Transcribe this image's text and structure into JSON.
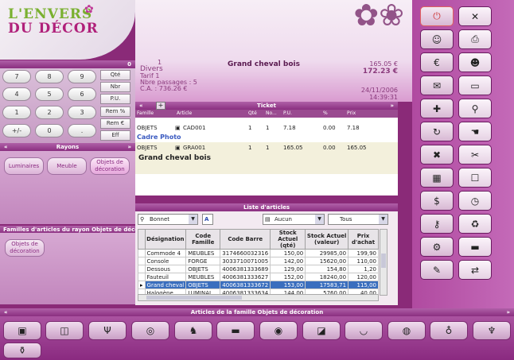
{
  "logo": {
    "line1": "L'ENVERS",
    "line2": "DU DÉCOR"
  },
  "info": {
    "number": "1",
    "category": "Divers",
    "tarif": "Tarif 1",
    "passages": "Nbre passages : 5",
    "ca": "C.A. : 736.26 €",
    "product": "Grand cheval bois",
    "price1": "165.05 €",
    "price2": "172.23 €",
    "date": "24/11/2006",
    "time": "14:39:31"
  },
  "keypad": {
    "counter": "0",
    "keys": [
      "7",
      "8",
      "9",
      "4",
      "5",
      "6",
      "1",
      "2",
      "3",
      "+/-",
      "0",
      "."
    ],
    "fkeys": [
      "Qté",
      "Nbr",
      "P.U.",
      "Rem %",
      "Rem €",
      "Eff"
    ]
  },
  "rayons": {
    "title": "Rayons",
    "items": [
      "Luminaires",
      "Meuble",
      "Objets de décoration"
    ]
  },
  "famarts": {
    "title": "Familles d'articles du rayon Objets de déco",
    "items": [
      "Objets de décoration"
    ]
  },
  "ticket": {
    "title": "Ticket",
    "headers": [
      "Famille",
      "Article",
      "Qté",
      "No...",
      "P.U.",
      "%",
      "Prix"
    ],
    "rows": [
      {
        "famille": "OBJETS",
        "article": "CAD001",
        "qte": "1",
        "no": "1",
        "pu": "7.18",
        "pct": "0.00",
        "prix": "7.18",
        "label": "Cadre Photo"
      },
      {
        "famille": "OBJETS",
        "article": "GRA001",
        "qte": "1",
        "no": "1",
        "pu": "165.05",
        "pct": "0.00",
        "prix": "165.05",
        "label": "Grand cheval bois"
      }
    ]
  },
  "list": {
    "title": "Liste d'articles",
    "combo1": "Bonnet",
    "combo2": "A",
    "combo3": "Aucun",
    "combo4": "Tous",
    "headers": [
      "Désignation",
      "Code Famille",
      "Code Barre",
      "Stock Actuel (qté)",
      "Stock Actuel (valeur)",
      "Prix d'achat"
    ],
    "rows": [
      [
        "Commode 4",
        "MEUBLES",
        "3174660032316",
        "150,00",
        "29985,00",
        "199,90"
      ],
      [
        "Console",
        "FORGE",
        "3033710071005",
        "142,00",
        "15620,00",
        "110,00"
      ],
      [
        "Dessous",
        "OBJETS",
        "4006381333689",
        "129,00",
        "154,80",
        "1,20"
      ],
      [
        "Fauteuil",
        "MEUBLES",
        "4006381333627",
        "152,00",
        "18240,00",
        "120,00"
      ],
      [
        "Grand cheval",
        "OBJETS",
        "4006381333672",
        "153,00",
        "17583,71",
        "115,00"
      ],
      [
        "Halogène",
        "LUMINAI",
        "4006381333634",
        "144,00",
        "5760,00",
        "40,00"
      ]
    ]
  },
  "bottom": {
    "title": "Articles de la famille Objets de décoration"
  },
  "colors": {
    "brand": "#8a2a78",
    "accent": "#b0207a",
    "selection": "#3a6ebe"
  }
}
